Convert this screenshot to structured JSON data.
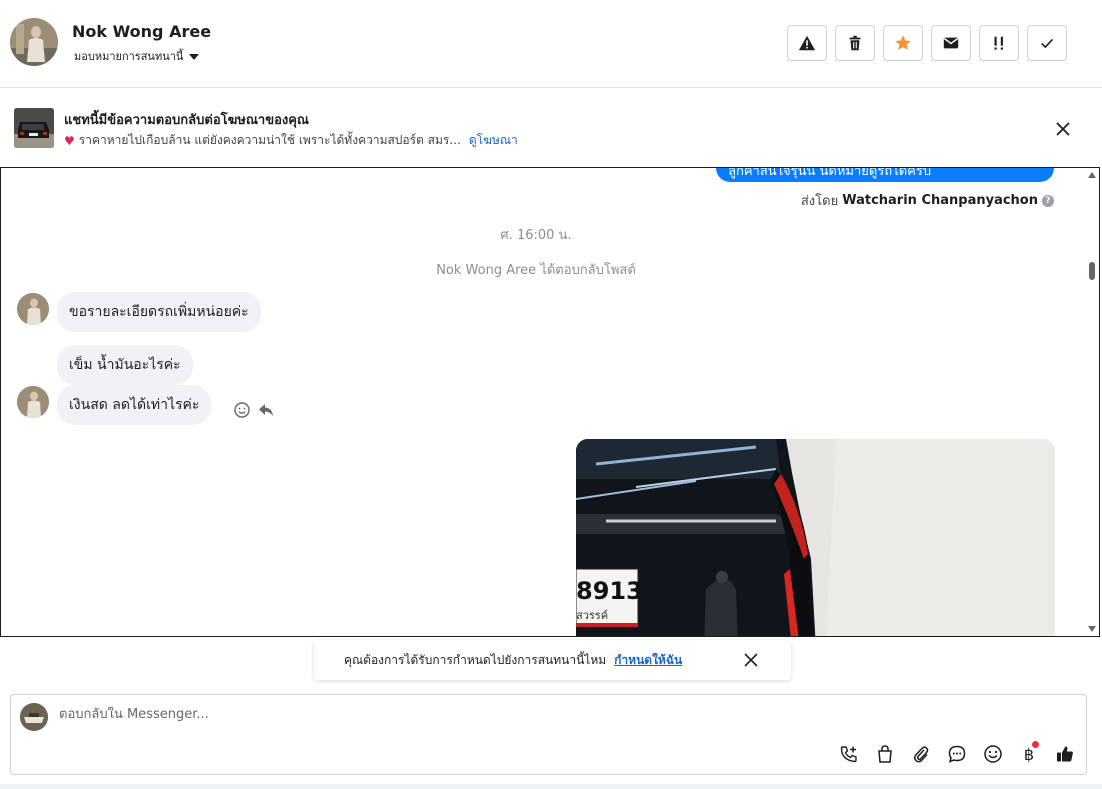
{
  "header": {
    "name": "Nok Wong Aree",
    "assign_label": "มอบหมายการสนทนานี้",
    "toolbar": [
      "spam-icon",
      "trash-icon",
      "star-icon",
      "envelope-icon",
      "follow-up-icon",
      "check-icon"
    ],
    "colors": {
      "star": "#f7923b",
      "icon": "#1c1e21"
    }
  },
  "ad_banner": {
    "title": "แชทนี้มีข้อความตอบกลับต่อโฆษณาของคุณ",
    "snippet": "ราคาหายไปเกือบล้าน แต่ยังคงความน่าใช้ เพราะได้ทั้งความสปอร์ต สมร...",
    "link_label": "ดูโฆษณา"
  },
  "messages": {
    "outgoing_partial": "ลูกค้าสนใจรุ่นนี้ นัดหมายดูรถได้ครับ",
    "sent_by_prefix": "ส่งโดย",
    "sent_by_name": "Watcharin Chanpanyachon",
    "timestamp": "ศ. 16:00 น.",
    "reply_note": "Nok Wong Aree ได้ตอบกลับโพสต์",
    "incoming": [
      "ขอรายละเอียดรถเพิ่มหน่อยค่ะ",
      "เข็ม น้ำมันอะไรค่ะ",
      "เงินสด ลดได้เท่าไรค่ะ"
    ],
    "plate_text": "8913",
    "plate_province": "สวรรค์",
    "colors": {
      "outgoing_bubble": "#0a7cff",
      "incoming_bubble": "#f0f2f5"
    }
  },
  "assign_prompt": {
    "text": "คุณต้องการได้รับการกำหนดไปยังการสนทนานี้ไหม",
    "link_label": "กำหนดให้ฉัน"
  },
  "composer": {
    "placeholder": "ตอบกลับใน Messenger...",
    "icons": [
      "call-add-icon",
      "shopping-bag-icon",
      "paperclip-icon",
      "saved-reply-icon",
      "emoji-icon",
      "baht-payment-icon",
      "thumbs-up-icon"
    ],
    "baht_symbol": "฿"
  }
}
